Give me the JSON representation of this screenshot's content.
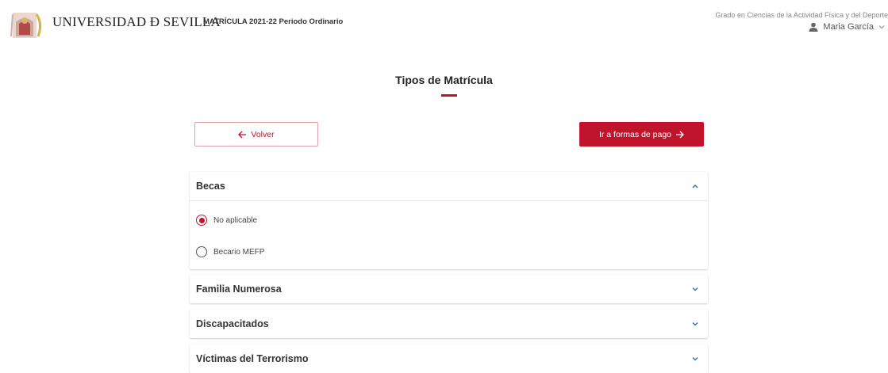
{
  "header": {
    "university_name": "UNIVERSIDAD Ð SEVILLA",
    "course_title": "MATRÍCULA 2021-22 Periodo Ordinario",
    "degree": "Grado en Ciencias de la Actividad Física y del Deporte",
    "user_name": "Maria García",
    "user_icon": "user-icon",
    "user_menu_icon": "chevron-down-icon",
    "logo_icon": "university-seal-logo"
  },
  "main": {
    "title": "Tipos de Matrícula",
    "back_button": {
      "label": "Volver",
      "icon": "arrow-left-icon"
    },
    "next_button": {
      "label": "Ir a formas de pago",
      "icon": "arrow-right-icon"
    }
  },
  "sections": [
    {
      "title": "Becas",
      "expanded": true,
      "options": [
        {
          "label": "No aplicable",
          "selected": true
        },
        {
          "label": "Becario MEFP",
          "selected": false
        }
      ]
    },
    {
      "title": "Familia Numerosa",
      "expanded": false
    },
    {
      "title": "Discapacitados",
      "expanded": false
    },
    {
      "title": "Víctimas del Terrorismo",
      "expanded": false
    }
  ],
  "colors": {
    "accent": "#c0142c",
    "chevron": "#2f78b7",
    "text": "#333333"
  }
}
